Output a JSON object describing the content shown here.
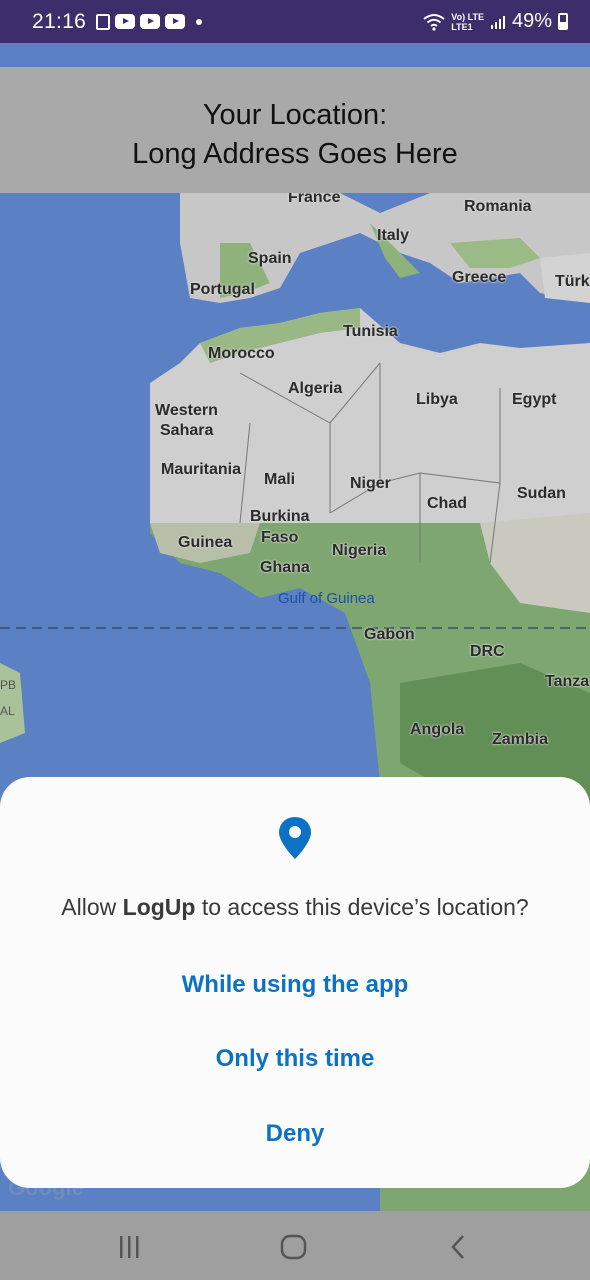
{
  "status_bar": {
    "time": "21:16",
    "network_top": "Vo) LTE",
    "network_bottom": "LTE1",
    "battery": "49%",
    "icons": [
      "notes-icon",
      "youtube-icon",
      "youtube-icon",
      "youtube-icon",
      "notification-dot-icon",
      "wifi-icon",
      "signal-icon",
      "battery-icon"
    ]
  },
  "header": {
    "line1": "Your Location:",
    "line2": "Long Address Goes Here"
  },
  "map": {
    "labels": {
      "france": "France",
      "romania": "Romania",
      "italy": "Italy",
      "spain": "Spain",
      "portugal": "Portugal",
      "greece": "Greece",
      "turkey": "Türk",
      "tunisia": "Tunisia",
      "morocco": "Morocco",
      "algeria": "Algeria",
      "libya": "Libya",
      "egypt": "Egypt",
      "western": "Western",
      "sahara": "Sahara",
      "mauritania": "Mauritania",
      "mali": "Mali",
      "niger": "Niger",
      "chad": "Chad",
      "sudan": "Sudan",
      "burkina": "Burkina",
      "faso": "Faso",
      "guinea": "Guinea",
      "nigeria": "Nigeria",
      "ghana": "Ghana",
      "gulf": "Gulf of Guinea",
      "gabon": "Gabon",
      "drc": "DRC",
      "tanza": "Tanza",
      "angola": "Angola",
      "zambia": "Zambia",
      "pb": "PB",
      "al": "AL"
    },
    "attribution": "Google"
  },
  "dialog": {
    "message_prefix": "Allow ",
    "app_name": "LogUp",
    "message_suffix": " to access this device’s location?",
    "btn_while_using": "While using the app",
    "btn_only_this_time": "Only this time",
    "btn_deny": "Deny",
    "accent_color": "#0d72c6"
  },
  "nav_bar": {
    "buttons": [
      "recent-apps-icon",
      "home-icon",
      "back-icon"
    ]
  }
}
